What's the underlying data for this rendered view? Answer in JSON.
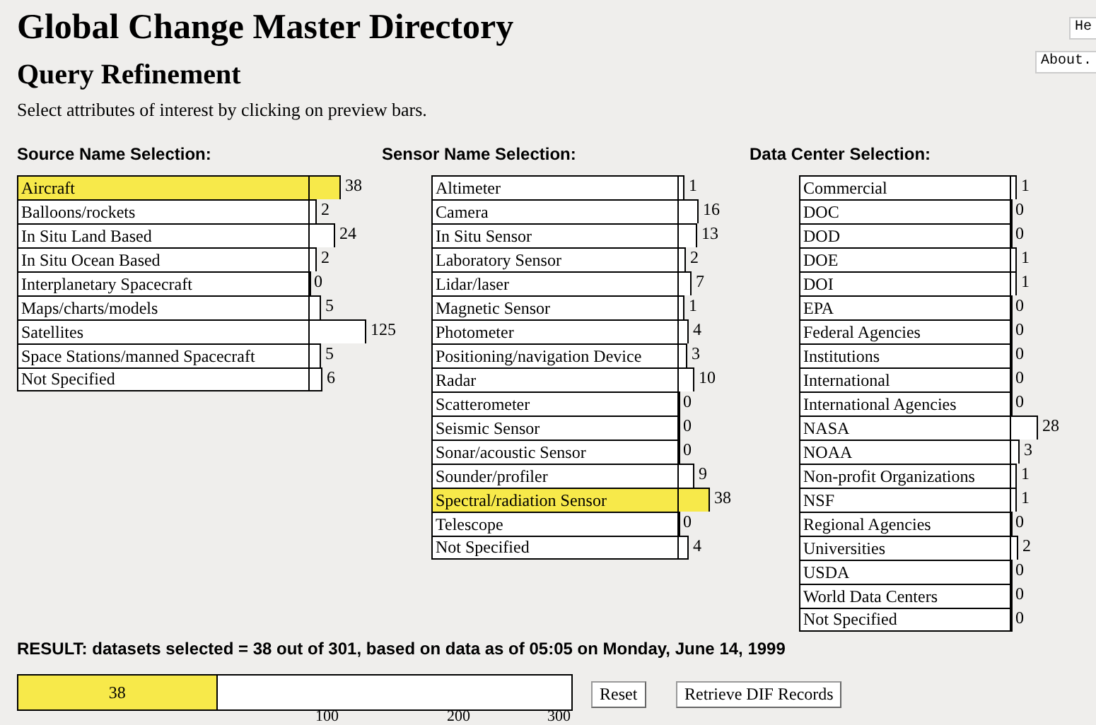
{
  "top_buttons": [
    "He",
    "About."
  ],
  "title": "Global Change Master Directory",
  "subtitle": "Query Refinement",
  "instructions": "Select attributes of interest by clicking on preview bars.",
  "sections": [
    {
      "heading": "Source Name Selection:",
      "items": [
        {
          "label": "Aircraft",
          "count": "38",
          "selected": true
        },
        {
          "label": "Balloons/rockets",
          "count": "2",
          "selected": false
        },
        {
          "label": "In Situ Land Based",
          "count": "24",
          "selected": false
        },
        {
          "label": "In Situ Ocean Based",
          "count": "2",
          "selected": false
        },
        {
          "label": "Interplanetary Spacecraft",
          "count": "0",
          "selected": false
        },
        {
          "label": "Maps/charts/models",
          "count": "5",
          "selected": false
        },
        {
          "label": "Satellites",
          "count": "125",
          "selected": false
        },
        {
          "label": "Space Stations/manned Spacecraft",
          "count": "5",
          "selected": false
        },
        {
          "label": "Not Specified",
          "count": "6",
          "selected": false
        }
      ]
    },
    {
      "heading": "Sensor Name Selection:",
      "items": [
        {
          "label": "Altimeter",
          "count": "1",
          "selected": false
        },
        {
          "label": "Camera",
          "count": "16",
          "selected": false
        },
        {
          "label": "In Situ Sensor",
          "count": "13",
          "selected": false
        },
        {
          "label": "Laboratory Sensor",
          "count": "2",
          "selected": false
        },
        {
          "label": "Lidar/laser",
          "count": "7",
          "selected": false
        },
        {
          "label": "Magnetic Sensor",
          "count": "1",
          "selected": false
        },
        {
          "label": "Photometer",
          "count": "4",
          "selected": false
        },
        {
          "label": "Positioning/navigation Device",
          "count": "3",
          "selected": false
        },
        {
          "label": "Radar",
          "count": "10",
          "selected": false
        },
        {
          "label": "Scatterometer",
          "count": "0",
          "selected": false
        },
        {
          "label": "Seismic Sensor",
          "count": "0",
          "selected": false
        },
        {
          "label": "Sonar/acoustic Sensor",
          "count": "0",
          "selected": false
        },
        {
          "label": "Sounder/profiler",
          "count": "9",
          "selected": false
        },
        {
          "label": "Spectral/radiation Sensor",
          "count": "38",
          "selected": true
        },
        {
          "label": "Telescope",
          "count": "0",
          "selected": false
        },
        {
          "label": "Not Specified",
          "count": "4",
          "selected": false
        }
      ]
    },
    {
      "heading": "Data Center Selection:",
      "items": [
        {
          "label": "Commercial",
          "count": "1",
          "selected": false
        },
        {
          "label": "DOC",
          "count": "0",
          "selected": false
        },
        {
          "label": "DOD",
          "count": "0",
          "selected": false
        },
        {
          "label": "DOE",
          "count": "1",
          "selected": false
        },
        {
          "label": "DOI",
          "count": "1",
          "selected": false
        },
        {
          "label": "EPA",
          "count": "0",
          "selected": false
        },
        {
          "label": "Federal Agencies",
          "count": "0",
          "selected": false
        },
        {
          "label": "Institutions",
          "count": "0",
          "selected": false
        },
        {
          "label": "International",
          "count": "0",
          "selected": false
        },
        {
          "label": "International Agencies",
          "count": "0",
          "selected": false
        },
        {
          "label": "NASA",
          "count": "28",
          "selected": false
        },
        {
          "label": "NOAA",
          "count": "3",
          "selected": false
        },
        {
          "label": "Non-profit Organizations",
          "count": "1",
          "selected": false
        },
        {
          "label": "NSF",
          "count": "1",
          "selected": false
        },
        {
          "label": "Regional Agencies",
          "count": "0",
          "selected": false
        },
        {
          "label": "Universities",
          "count": "2",
          "selected": false
        },
        {
          "label": "USDA",
          "count": "0",
          "selected": false
        },
        {
          "label": "World Data Centers",
          "count": "0",
          "selected": false
        },
        {
          "label": "Not Specified",
          "count": "0",
          "selected": false
        }
      ]
    }
  ],
  "result": {
    "text": "RESULT: datasets selected = 38 out of 301, based on data as of 05:05 on Monday, June 14, 1999",
    "bar_value": "38",
    "level": 0.36,
    "ticks": [
      "100",
      "200",
      "300"
    ]
  },
  "buttons": [
    "Reset",
    "Retrieve DIF Records"
  ]
}
